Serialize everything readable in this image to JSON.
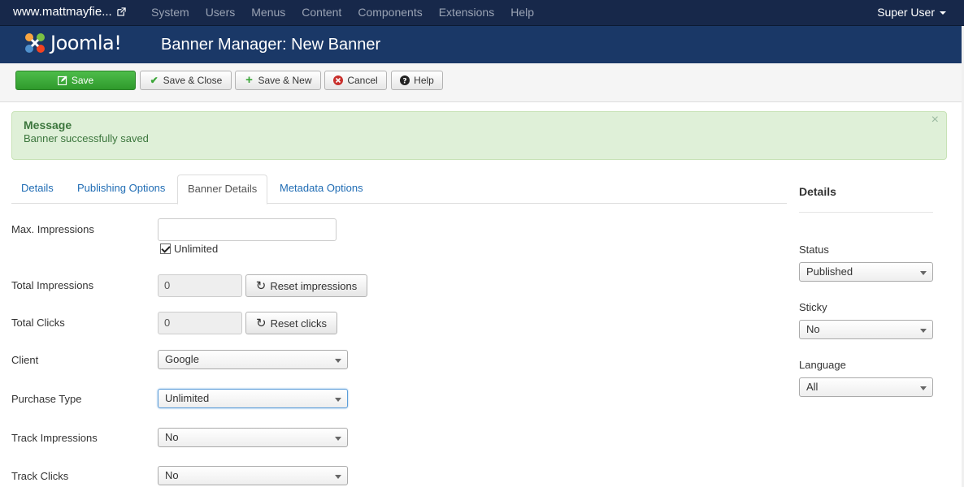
{
  "navbar": {
    "site": "www.mattmayfie...",
    "menu": [
      "System",
      "Users",
      "Menus",
      "Content",
      "Components",
      "Extensions",
      "Help"
    ],
    "user": "Super User"
  },
  "header": {
    "logo_text": "Joomla!",
    "title": "Banner Manager: New Banner"
  },
  "toolbar": {
    "save": "Save",
    "save_close": "Save & Close",
    "save_new": "Save & New",
    "cancel": "Cancel",
    "help": "Help"
  },
  "message": {
    "heading": "Message",
    "text": "Banner successfully saved",
    "close": "×"
  },
  "tabs": [
    {
      "label": "Details"
    },
    {
      "label": "Publishing Options"
    },
    {
      "label": "Banner Details"
    },
    {
      "label": "Metadata Options"
    }
  ],
  "form": {
    "max_impressions": {
      "label": "Max. Impressions",
      "value": "",
      "unlimited_label": "Unlimited",
      "unlimited_checked": true
    },
    "total_impressions": {
      "label": "Total Impressions",
      "value": "0",
      "reset_label": "Reset impressions"
    },
    "total_clicks": {
      "label": "Total Clicks",
      "value": "0",
      "reset_label": "Reset clicks"
    },
    "client": {
      "label": "Client",
      "value": "Google"
    },
    "purchase_type": {
      "label": "Purchase Type",
      "value": "Unlimited"
    },
    "track_impressions": {
      "label": "Track Impressions",
      "value": "No"
    },
    "track_clicks": {
      "label": "Track Clicks",
      "value": "No"
    }
  },
  "sidebar": {
    "title": "Details",
    "status": {
      "label": "Status",
      "value": "Published"
    },
    "sticky": {
      "label": "Sticky",
      "value": "No"
    },
    "language": {
      "label": "Language",
      "value": "All"
    }
  },
  "colors": {
    "navbar_bg": "#17284a",
    "header_bg": "#1a3867",
    "save_green": "#3aa637",
    "alert_bg": "#dff0d8",
    "link_blue": "#1f6cb4"
  }
}
